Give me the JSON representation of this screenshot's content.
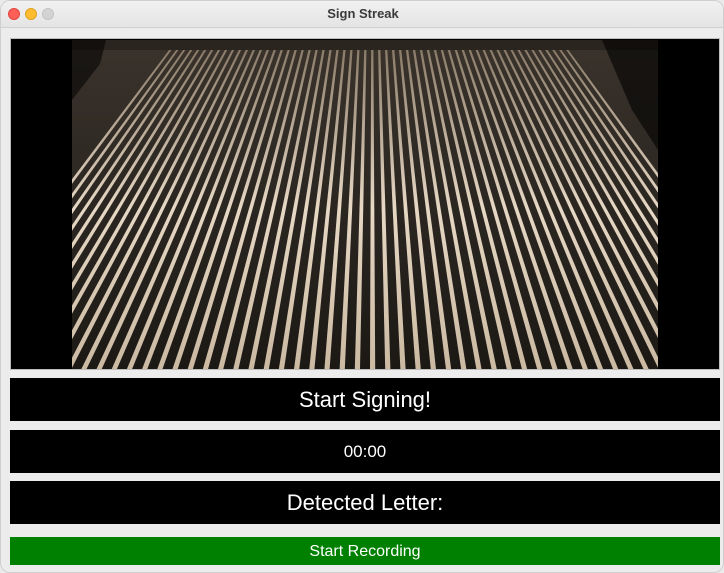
{
  "window": {
    "title": "Sign Streak"
  },
  "camera_feed": {
    "description_icon": "camera-feed-image"
  },
  "status": {
    "text": "Start Signing!"
  },
  "timer": {
    "text": "00:00"
  },
  "detected": {
    "text": "Detected Letter:"
  },
  "record_button": {
    "label": "Start Recording",
    "color": "#008000"
  }
}
